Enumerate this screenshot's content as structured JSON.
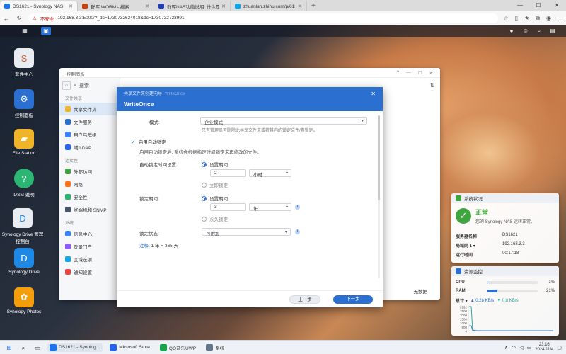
{
  "browser": {
    "tabs": [
      {
        "title": "DS1621 - Synology NAS",
        "color": "#1a73e8",
        "active": true
      },
      {
        "title": "群晖 WORM - 搜索",
        "color": "#c2410c",
        "active": false
      },
      {
        "title": "群晖NAS功能说明: 什么是Write...",
        "color": "#1e40af",
        "active": false
      },
      {
        "title": "zhuanlan.zhihu.com/p/61283340...",
        "color": "#0ea5e9",
        "active": false
      }
    ],
    "new_tab": "+",
    "insecure_label": "不安全",
    "url": "192.168.3.3:5000/?_dc=1730732624018&dc=1730732723991"
  },
  "desktop_icons": [
    {
      "label": "套件中心",
      "glyph": "S",
      "color": "#e9edf2"
    },
    {
      "label": "控制面板",
      "glyph": "⚙",
      "color": "#2b6fd1"
    },
    {
      "label": "File Station",
      "glyph": "▰",
      "color": "#f0b429"
    },
    {
      "label": "DSM 说明",
      "glyph": "?",
      "color": "#2bb673"
    },
    {
      "label": "Synology Drive 管理控制台",
      "glyph": "D",
      "color": "#e9edf2"
    },
    {
      "label": "Synology Drive",
      "glyph": "D",
      "color": "#1e88e5"
    },
    {
      "label": "Synology Photos",
      "glyph": "✿",
      "color": "#f59e0b"
    }
  ],
  "control_panel": {
    "title": "控制面板",
    "search_placeholder": "搜索",
    "sections": [
      {
        "header": "文件共享",
        "items": [
          "共享文件夹",
          "文件服务",
          "用户与群组",
          "域/LDAP"
        ]
      },
      {
        "header": "连接性",
        "items": [
          "外部访问",
          "网络",
          "安全性",
          "终端机和 SNMP"
        ]
      },
      {
        "header": "系统",
        "items": [
          "信息中心",
          "登录门户",
          "区域选项",
          "通知设置"
        ]
      }
    ],
    "selected_item": "共享文件夹",
    "footer_text": "无数据"
  },
  "wizard": {
    "crumb": "共享文件夹创建向导",
    "crumb_sub": "WriteOnce",
    "title": "WriteOnce",
    "mode_label": "模式:",
    "mode_value": "企业模式",
    "mode_hint": "只有管理员可删除此共享文件夹或将其内的锁定文件/卷锁定。",
    "auto_lock_label": "启用自动锁定",
    "auto_lock_hint": "启用自动锁定后, 系统会根据指定时间锁定未再修改的文件。",
    "auto_lock_time_label": "自动锁定时间设置:",
    "opt_set_period": "设置期间",
    "auto_lock_value": "2",
    "auto_lock_unit": "小时",
    "opt_immediate": "立即锁定",
    "lock_period_label": "锁定期间:",
    "lock_period_value": "3",
    "lock_period_unit": "年",
    "opt_permanent": "永久锁定",
    "lock_state_label": "锁定状态:",
    "lock_state_value": "可附加",
    "note_label": "注释:",
    "note_text": "1 年 = 365 天",
    "btn_prev": "上一步",
    "btn_next": "下一步"
  },
  "system_status": {
    "title": "系统状况",
    "status": "正常",
    "status_desc": "您的 Synology NAS 运转正常。",
    "rows": [
      {
        "k": "服务器名称",
        "v": "DS1621"
      },
      {
        "k": "局域网 1 ▾",
        "v": "192.168.3.3"
      },
      {
        "k": "运行时间",
        "v": "00:17:18"
      }
    ]
  },
  "resource_monitor": {
    "title": "资源监控",
    "cpu_label": "CPU",
    "cpu_value": "1%",
    "cpu_fraction": 0.01,
    "ram_label": "RAM",
    "ram_value": "21%",
    "ram_fraction": 0.21,
    "total_label": "总计 ▾",
    "up": "▲ 0.28 KB/s",
    "down": "▼ 0.8 KB/s",
    "y_ticks": [
      "2992",
      "2500",
      "2000",
      "1500",
      "1000",
      "500",
      "0"
    ]
  },
  "taskbar": {
    "apps": [
      {
        "label": "DS1621 - Synolog...",
        "color": "#1a73e8",
        "active": true
      },
      {
        "label": "Microsoft Store",
        "color": "#2563eb",
        "active": false
      },
      {
        "label": "QQ音乐UWP",
        "color": "#16a34a",
        "active": false
      },
      {
        "label": "系统",
        "color": "#64748b",
        "active": false
      }
    ],
    "time": "23:16",
    "date": "2024/11/4"
  }
}
